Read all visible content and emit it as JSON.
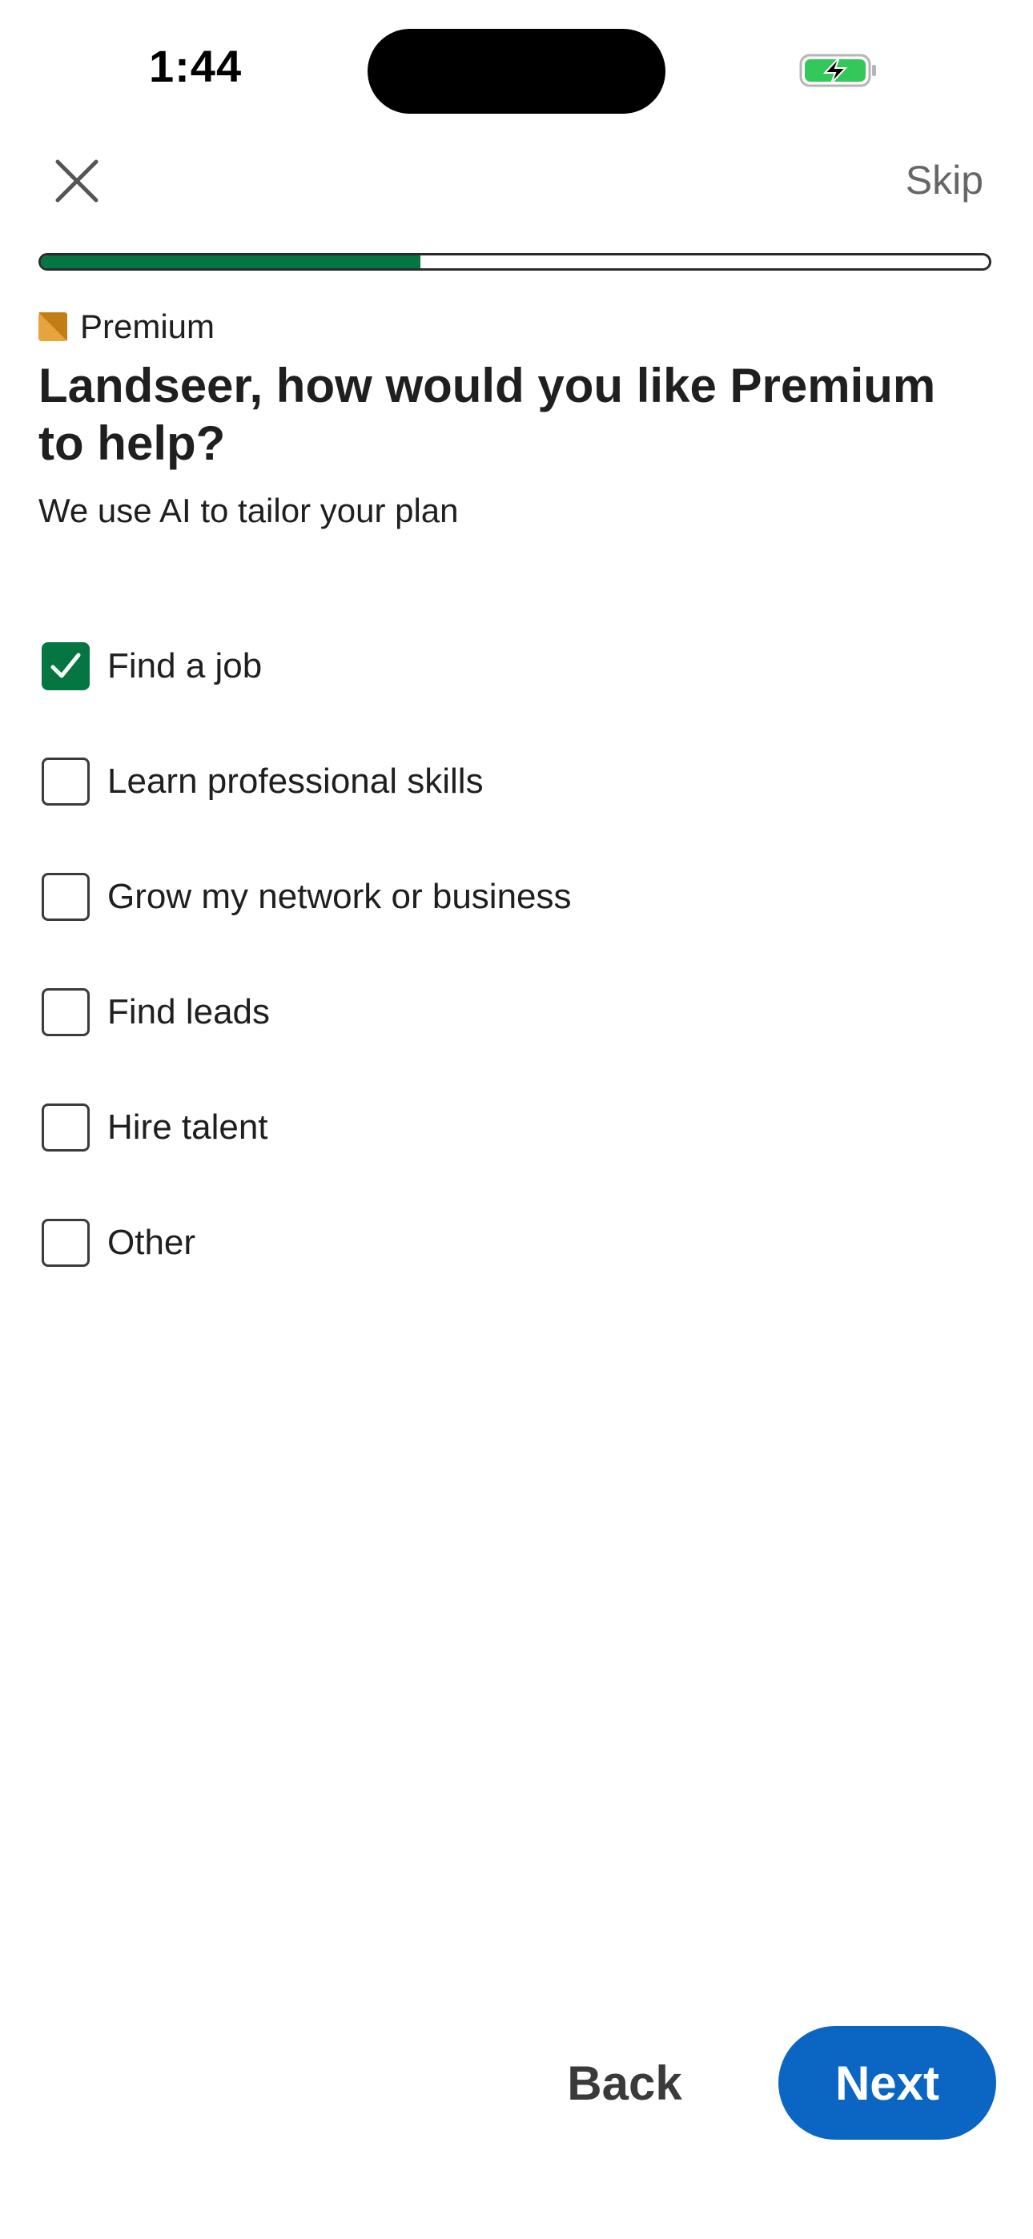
{
  "status_bar": {
    "time": "1:44",
    "battery_icon": "battery-charging-icon",
    "battery_color": "#34c759"
  },
  "header": {
    "close_icon": "close-icon",
    "skip_label": "Skip"
  },
  "progress": {
    "value": 0.4,
    "fill_color": "#057642"
  },
  "premium": {
    "icon": "premium-badge-icon",
    "label": "Premium",
    "color": "#e7a33e"
  },
  "title": "Landseer, how would you like Premium to help?",
  "subtitle": "We use AI to tailor your plan",
  "options": [
    {
      "label": "Find a job",
      "checked": true
    },
    {
      "label": "Learn professional skills",
      "checked": false
    },
    {
      "label": "Grow my network or business",
      "checked": false
    },
    {
      "label": "Find leads",
      "checked": false
    },
    {
      "label": "Hire talent",
      "checked": false
    },
    {
      "label": "Other",
      "checked": false
    }
  ],
  "footer": {
    "back_label": "Back",
    "next_label": "Next",
    "next_color": "#0a66c2"
  }
}
